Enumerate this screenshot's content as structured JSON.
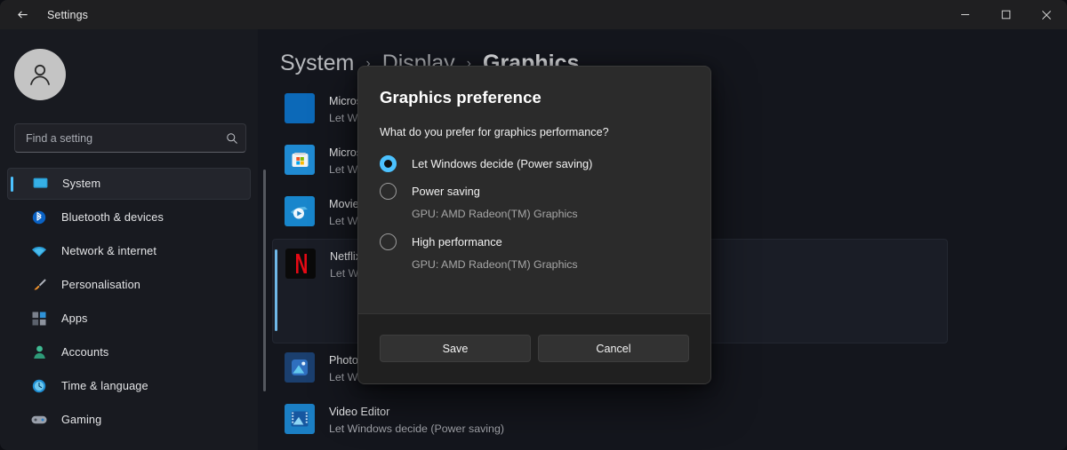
{
  "window": {
    "title": "Settings",
    "back_icon": "back-arrow-icon",
    "controls": {
      "minimize": "minimize-icon",
      "maximize": "maximize-icon",
      "close": "close-icon"
    }
  },
  "sidebar": {
    "avatar_icon": "user-avatar-icon",
    "search": {
      "placeholder": "Find a setting",
      "value": "",
      "icon": "search-icon"
    },
    "items": [
      {
        "label": "System",
        "icon": "monitor-icon",
        "selected": true
      },
      {
        "label": "Bluetooth & devices",
        "icon": "bluetooth-icon",
        "selected": false
      },
      {
        "label": "Network & internet",
        "icon": "wifi-icon",
        "selected": false
      },
      {
        "label": "Personalisation",
        "icon": "paintbrush-icon",
        "selected": false
      },
      {
        "label": "Apps",
        "icon": "apps-icon",
        "selected": false
      },
      {
        "label": "Accounts",
        "icon": "person-icon",
        "selected": false
      },
      {
        "label": "Time & language",
        "icon": "clock-icon",
        "selected": false
      },
      {
        "label": "Gaming",
        "icon": "gamepad-icon",
        "selected": false
      }
    ]
  },
  "main": {
    "breadcrumb": {
      "segments": [
        "System",
        "Display",
        "Graphics"
      ],
      "separator": "›"
    },
    "app_list": [
      {
        "name": "Microsoft",
        "subtitle": "Let Windows decide (Power saving)",
        "icon": "generic-blue-app-icon",
        "expanded": false
      },
      {
        "name": "Microsoft",
        "subtitle": "Let Windows decide (Power saving)",
        "icon": "microsoft-store-icon",
        "expanded": false
      },
      {
        "name": "Movies & TV",
        "subtitle": "Let Windows decide (Power saving)",
        "icon": "movies-tv-icon",
        "expanded": false
      },
      {
        "name": "Netflix",
        "subtitle": "Let Windows decide (Power saving)",
        "icon": "netflix-icon",
        "expanded": true
      },
      {
        "name": "Photos",
        "subtitle": "Let Windows decide (Power saving)",
        "icon": "photos-icon",
        "expanded": false
      },
      {
        "name": "Video Editor",
        "subtitle": "Let Windows decide (Power saving)",
        "icon": "video-editor-icon",
        "expanded": false
      }
    ]
  },
  "dialog": {
    "title": "Graphics preference",
    "question": "What do you prefer for graphics performance?",
    "options": [
      {
        "label": "Let Windows decide (Power saving)",
        "gpu": "",
        "checked": true
      },
      {
        "label": "Power saving",
        "gpu": "GPU: AMD Radeon(TM) Graphics",
        "checked": false
      },
      {
        "label": "High performance",
        "gpu": "GPU: AMD Radeon(TM) Graphics",
        "checked": false
      }
    ],
    "save_label": "Save",
    "cancel_label": "Cancel"
  },
  "colors": {
    "accent": "#4cc2ff",
    "window_bg": "#14161d",
    "sidebar_bg": "#181a20",
    "dialog_bg": "#2b2b2b",
    "dialog_footer_bg": "#202020"
  }
}
